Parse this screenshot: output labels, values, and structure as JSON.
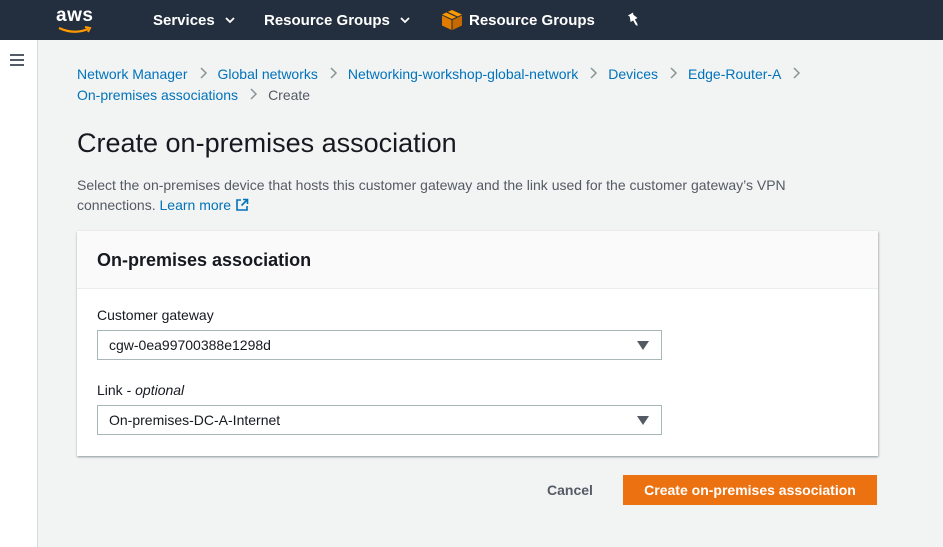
{
  "topnav": {
    "logo_text": "aws",
    "services_label": "Services",
    "resource_groups_label": "Resource Groups",
    "pinned_label": "Resource Groups"
  },
  "colors": {
    "nav_bg": "#232f3e",
    "link": "#0073bb",
    "primary_button": "#ec7211",
    "logo_smile": "#ff9900"
  },
  "breadcrumb": {
    "items": [
      "Network Manager",
      "Global networks",
      "Networking-workshop-global-network",
      "Devices",
      "Edge-Router-A",
      "On-premises associations"
    ],
    "current": "Create"
  },
  "page": {
    "title": "Create on-premises association",
    "description": "Select the on-premises device that hosts this customer gateway and the link used for the customer gateway’s VPN connections.",
    "learn_more": "Learn more"
  },
  "card": {
    "header": "On-premises association",
    "customer_gateway": {
      "label": "Customer gateway",
      "value": "cgw-0ea99700388e1298d"
    },
    "link": {
      "label": "Link - ",
      "label_optional": "optional",
      "value": "On-premises-DC-A-Internet"
    }
  },
  "actions": {
    "cancel": "Cancel",
    "create": "Create on-premises association"
  },
  "icons": [
    "aws-logo-icon",
    "chevron-down-icon",
    "box-icon",
    "pin-icon",
    "hamburger-icon",
    "external-link-icon",
    "caret-down-icon"
  ]
}
